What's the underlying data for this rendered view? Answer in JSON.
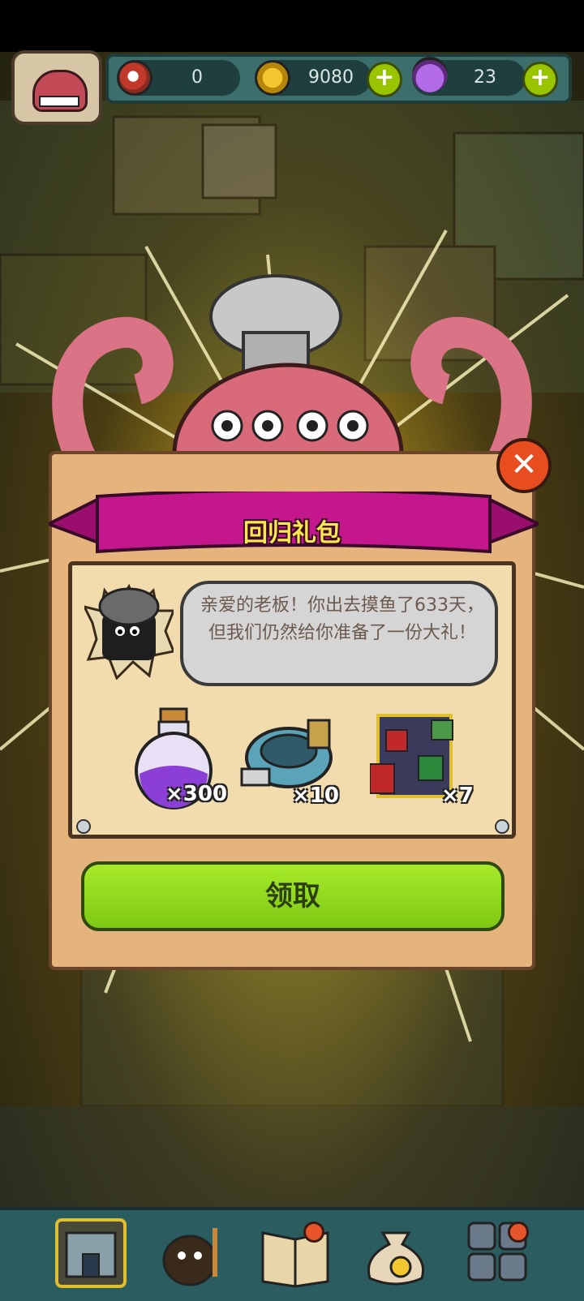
{
  "resources": {
    "eyeball_count": "0",
    "coins": "9080",
    "potions": "23"
  },
  "popup": {
    "title": "回归礼包",
    "message": "亲爱的老板！你出去摸鱼了633天，但我们仍然给你准备了一份大礼！",
    "rewards": [
      {
        "icon": "purple-potion-icon",
        "quantity": "×300"
      },
      {
        "icon": "machine-gear-icon",
        "quantity": "×10"
      },
      {
        "icon": "gift-crate-icon",
        "quantity": "×7"
      }
    ],
    "claim_label": "领取",
    "close_symbol": "✕"
  },
  "colors": {
    "ribbon": "#c4178e",
    "claim_button": "#8fd61c",
    "close_button": "#e84d20",
    "title_text": "#ffe84d"
  },
  "nav": [
    {
      "icon": "shop-building-icon"
    },
    {
      "icon": "monster-staff-icon"
    },
    {
      "icon": "recipe-book-icon"
    },
    {
      "icon": "money-bag-icon"
    },
    {
      "icon": "grid-menu-icon"
    }
  ]
}
